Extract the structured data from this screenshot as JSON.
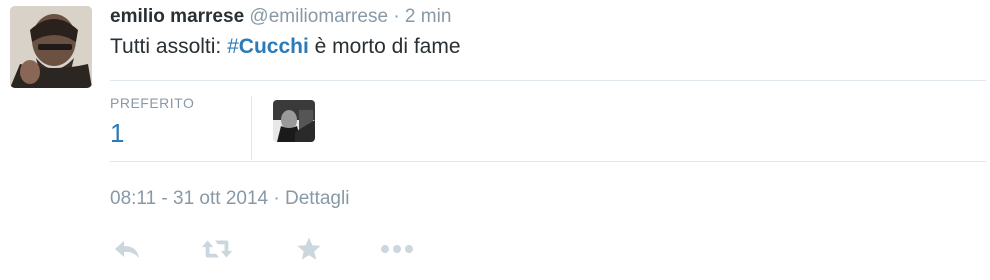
{
  "tweet": {
    "fullname": "emilio marrese",
    "username": "@emiliomarrese",
    "separator": "·",
    "time": "2 min",
    "text_before": "Tutti assolti: ",
    "hashtag_symbol": "#",
    "hashtag_word": "Cucchi",
    "text_after": " è morto di fame",
    "stats": {
      "favorites_label": "PREFERITO",
      "favorites_count": "1"
    },
    "timestamp": "08:11 - 31 ott 2014",
    "meta_separator": "·",
    "details_link": "Dettagli",
    "actions": [
      "reply-icon",
      "retweet-icon",
      "favorite-icon",
      "more-icon"
    ]
  },
  "colors": {
    "link": "#2b7bb9",
    "secondary_text": "#8899a6",
    "primary_text": "#292f33",
    "divider": "#e1e8ed",
    "action_icon": "#ccd6dd"
  }
}
